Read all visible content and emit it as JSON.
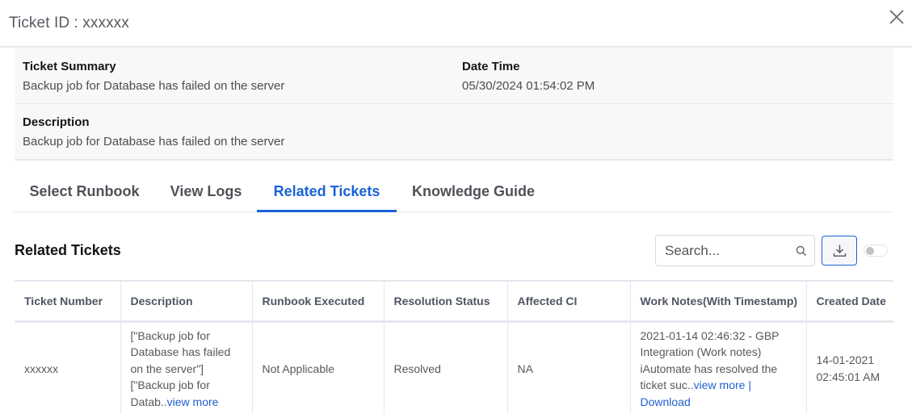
{
  "dialog": {
    "title": "Ticket ID : xxxxxx",
    "close_icon": "close-x-icon"
  },
  "info": {
    "summary_label": "Ticket Summary",
    "summary_value": "Backup job for Database has failed on the server",
    "datetime_label": "Date Time",
    "datetime_value": "05/30/2024 01:54:02 PM",
    "description_label": "Description",
    "description_value": "Backup job for Database has failed on the server"
  },
  "tabs": [
    {
      "label": "Select Runbook",
      "active": false
    },
    {
      "label": "View Logs",
      "active": false
    },
    {
      "label": "Related Tickets",
      "active": true
    },
    {
      "label": "Knowledge Guide",
      "active": false
    }
  ],
  "related": {
    "title": "Related Tickets",
    "search_placeholder": "Search...",
    "search_value": "",
    "search_icon": "search-icon",
    "download_icon": "download-icon",
    "toggle_on": false
  },
  "table": {
    "columns": [
      "Ticket Number",
      "Description",
      "Runbook Executed",
      "Resolution Status",
      "Affected CI",
      "Work Notes(With Timestamp)",
      "Created Date"
    ],
    "rows": [
      {
        "ticket_number": "xxxxxx",
        "description": "[\"Backup job for Database has failed on the server\"] [\"Backup job for Datab..",
        "description_link": "view more",
        "runbook_executed": "Not Applicable",
        "resolution_status": "Resolved",
        "affected_ci": "NA",
        "work_notes": "2021-01-14 02:46:32 - GBP Integration (Work notes) iAutomate has resolved the ticket suc..",
        "work_notes_view_link": "view more",
        "work_notes_separator": " | ",
        "work_notes_download_link": "Download",
        "created_date": "14-01-2021 02:45:01 AM"
      }
    ]
  },
  "colors": {
    "accent": "#1a63d6",
    "info_background": "#f7f8fa",
    "link": "#2060cf"
  }
}
